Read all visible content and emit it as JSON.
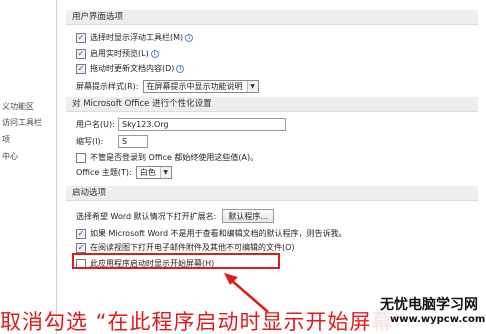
{
  "sidebar": {
    "items": [
      "",
      "",
      "",
      "",
      "",
      "义功能区",
      "访问工具栏",
      "项",
      "中心"
    ]
  },
  "ui_options": {
    "header": "用户界面选项",
    "mini_toolbar": "选择时显示浮动工具栏(M)",
    "live_preview": "启用实时预览(L)",
    "update_on_drag": "拖动时更新文档内容(D)",
    "screentip_label": "屏幕提示样式(R):",
    "screentip_value": "在屏幕提示中显示功能说明"
  },
  "personalize": {
    "header": "对 Microsoft Office 进行个性化设置",
    "username_label": "用户名(U):",
    "username_value": "Sky123.Org",
    "initials_label": "缩写(I):",
    "initials_value": "S",
    "always_use": "不管是否登录到 Office 都始终使用这些值(A)。",
    "theme_label": "Office 主题(T):",
    "theme_value": "白色"
  },
  "startup": {
    "header": "启动选项",
    "default_program_label": "选择希望 Word 默认情况下打开扩展名:",
    "default_programs_button": "默认程序...",
    "tell_me": "如果 Microsoft Word 不是用于查看和编辑文档的默认程序，则告诉我。",
    "open_email_attach": "在阅读视图下打开电子邮件附件及其他不可编辑的文件(O)",
    "show_start_screen": "此应用程序启动时显示开始屏幕(H)"
  },
  "annotation": {
    "caption": "取消勾选 “在此程序启动时显示开始屏幕”",
    "color": "#e01b1b"
  },
  "watermark": {
    "title": "无忧电脑学习网",
    "url": "www.wypcw.com"
  },
  "icons": {
    "checked": "checkmark-icon",
    "info": "info-icon",
    "dropdown": "chevron-down-icon",
    "arrow": "red-arrow-icon"
  }
}
